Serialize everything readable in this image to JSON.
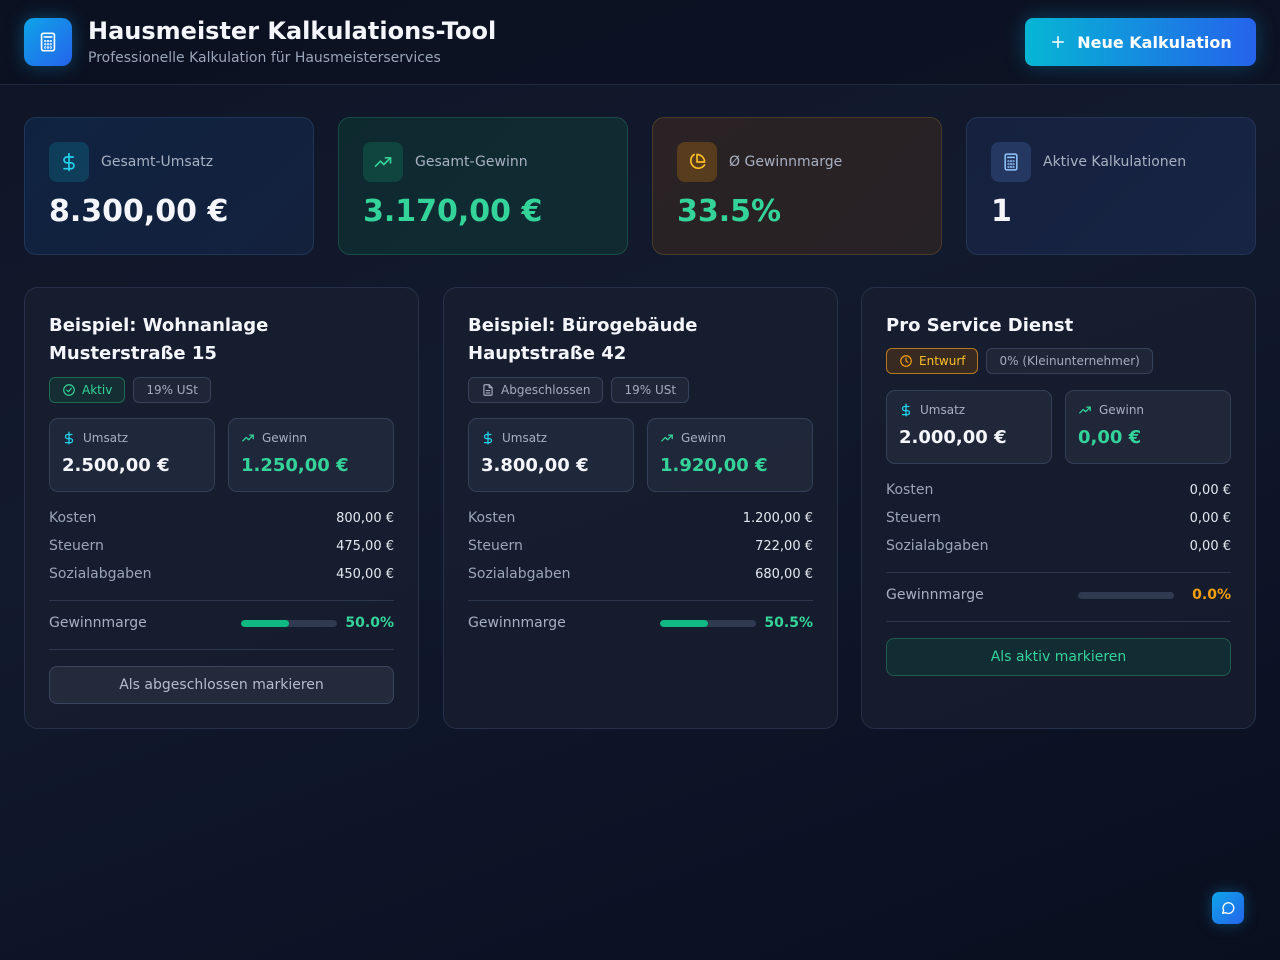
{
  "header": {
    "title": "Hausmeister Kalkulations-Tool",
    "subtitle": "Professionelle Kalkulation für Hausmeisterservices",
    "new_button_label": "Neue Kalkulation",
    "logo_icon": "calculator-icon"
  },
  "stats": [
    {
      "label": "Gesamt-Umsatz",
      "value": "8.300,00 €",
      "icon": "dollar-icon",
      "accent": "#06b6d4"
    },
    {
      "label": "Gesamt-Gewinn",
      "value": "3.170,00 €",
      "icon": "trending-up-icon",
      "accent": "#34d399"
    },
    {
      "label": "Ø Gewinnmarge",
      "value": "33.5%",
      "icon": "pie-chart-icon",
      "accent": "#f59e0b"
    },
    {
      "label": "Aktive Kalkulationen",
      "value": "1",
      "icon": "calculator-icon",
      "accent": "#60a5fa"
    }
  ],
  "cards": [
    {
      "title": "Beispiel: Wohnanlage Musterstraße 15",
      "status": "Aktiv",
      "tax": "19% USt",
      "umsatz_label": "Umsatz",
      "umsatz": "2.500,00 €",
      "gewinn_label": "Gewinn",
      "gewinn": "1.250,00 €",
      "rows": [
        {
          "label": "Kosten",
          "value": "800,00 €"
        },
        {
          "label": "Steuern",
          "value": "475,00 €"
        },
        {
          "label": "Sozialabgaben",
          "value": "450,00 €"
        }
      ],
      "margin_label": "Gewinnmarge",
      "margin_text": "50.0%",
      "margin_fraction": 0.5,
      "action": "Als abgeschlossen markieren"
    },
    {
      "title": "Beispiel: Bürogebäude Hauptstraße 42",
      "status": "Abgeschlossen",
      "tax": "19% USt",
      "umsatz_label": "Umsatz",
      "umsatz": "3.800,00 €",
      "gewinn_label": "Gewinn",
      "gewinn": "1.920,00 €",
      "rows": [
        {
          "label": "Kosten",
          "value": "1.200,00 €"
        },
        {
          "label": "Steuern",
          "value": "722,00 €"
        },
        {
          "label": "Sozialabgaben",
          "value": "680,00 €"
        }
      ],
      "margin_label": "Gewinnmarge",
      "margin_text": "50.5%",
      "margin_fraction": 0.505
    },
    {
      "title": "Pro Service Dienst",
      "status": "Entwurf",
      "tax": "0% (Kleinunternehmer)",
      "umsatz_label": "Umsatz",
      "umsatz": "2.000,00 €",
      "gewinn_label": "Gewinn",
      "gewinn": "0,00 €",
      "rows": [
        {
          "label": "Kosten",
          "value": "0,00 €"
        },
        {
          "label": "Steuern",
          "value": "0,00 €"
        },
        {
          "label": "Sozialabgaben",
          "value": "0,00 €"
        }
      ],
      "margin_label": "Gewinnmarge",
      "margin_text": "0.0%",
      "margin_fraction": 0.0,
      "action": "Als aktiv markieren"
    }
  ],
  "colors": {
    "accent_cyan": "#06b6d4",
    "accent_blue": "#2563eb",
    "profit_green": "#34d399",
    "warning_orange": "#f59e0b"
  },
  "chat_icon": "chat-bubble-icon"
}
